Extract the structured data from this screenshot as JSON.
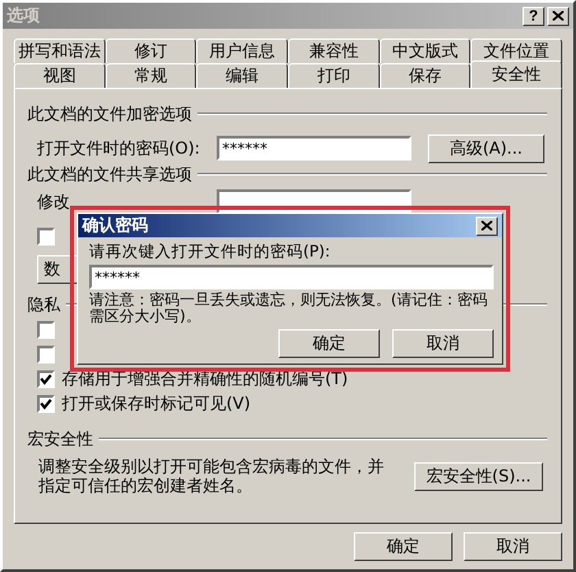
{
  "window": {
    "title": "选项",
    "help": "?"
  },
  "tab_rows": [
    [
      {
        "label": "拼写和语法",
        "selected": false
      },
      {
        "label": "修订",
        "selected": false
      },
      {
        "label": "用户信息",
        "selected": false
      },
      {
        "label": "兼容性",
        "selected": false
      },
      {
        "label": "中文版式",
        "selected": false
      },
      {
        "label": "文件位置",
        "selected": false
      }
    ],
    [
      {
        "label": "视图",
        "selected": false
      },
      {
        "label": "常规",
        "selected": false
      },
      {
        "label": "编辑",
        "selected": false
      },
      {
        "label": "打印",
        "selected": false
      },
      {
        "label": "保存",
        "selected": false
      },
      {
        "label": "安全性",
        "selected": true
      }
    ]
  ],
  "encryption": {
    "title": "此文档的文件加密选项",
    "open_password_label": "打开文件时的密码(O):",
    "open_password_value": "******",
    "advanced_button": "高级(A)..."
  },
  "sharing": {
    "title": "此文档的文件共享选项",
    "modify_label": "修改",
    "checkbox": {
      "checked": false
    },
    "button": "数"
  },
  "privacy": {
    "title": "隐私",
    "checkboxes": [
      {
        "checked": false
      },
      {
        "checked": false
      },
      {
        "label": "存储用于增强合并精确性的随机编号(T)",
        "checked": true
      },
      {
        "label": "打开或保存时标记可见(V)",
        "checked": true
      }
    ]
  },
  "macro": {
    "title": "宏安全性",
    "text": "调整安全级别以打开可能包含宏病毒的文件，并指定可信任的宏创建者姓名。",
    "button": "宏安全性(S)..."
  },
  "buttons": [
    "确定",
    "取消"
  ],
  "dialog": {
    "highlighted": true,
    "title": "确认密码",
    "prompt": "请再次键入打开文件时的密码(P):",
    "value": "******",
    "note": "请注意：密码一旦丢失或遗忘，则无法恢复。(请记住：密码需区分大小写)。",
    "buttons": [
      "确定",
      "取消"
    ]
  }
}
